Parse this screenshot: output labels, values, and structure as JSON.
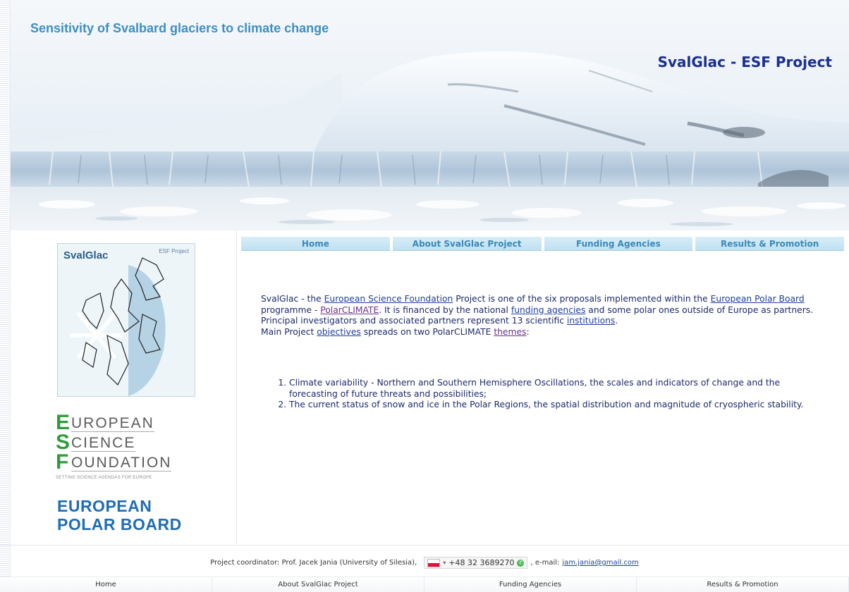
{
  "header": {
    "site_title": "Sensitivity of Svalbard glaciers to climate change",
    "project_title": "SvalGlac - ESF Project"
  },
  "logos": {
    "svalglac": {
      "brand": "SvalGlac",
      "sub": "ESF Project"
    },
    "esf": {
      "lines": [
        {
          "letter": "E",
          "word": "UROPEAN"
        },
        {
          "letter": "S",
          "word": "CIENCE"
        },
        {
          "letter": "F",
          "word": "OUNDATION"
        }
      ],
      "tagline": "SETTING SCIENCE AGENDAS FOR EUROPE"
    },
    "epb": {
      "line1": "EUROPEAN",
      "line2": "POLAR BOARD"
    }
  },
  "nav": {
    "items": [
      "Home",
      "About SvalGlac Project",
      "Funding Agencies",
      "Results & Promotion"
    ]
  },
  "content": {
    "p1": "SvalGlac - the ",
    "link_esf": "European Science Foundation",
    "p2": " Project is one of the six proposals implemented within the ",
    "link_epb": "European Polar Board",
    "p3": " programme - ",
    "link_polarclimate": "PolarCLIMATE",
    "p4": ". It is financed by the national ",
    "link_funding": "funding agencies",
    "p5": " and some polar ones outside of Europe as partners. Principal investigators and associated partners represent 13 scientific ",
    "link_institutions": "institutions",
    "p6": ".",
    "p7": "Main Project ",
    "link_objectives": "objectives",
    "p8": " spreads on two PolarCLIMATE ",
    "link_themes": "themes",
    "p9": ":",
    "list": [
      "Climate variability - Northern and Southern Hemisphere Oscillations, the scales and indicators of change and the forecasting of future threats and possibilities;",
      "The current status of snow and ice in the Polar Regions, the spatial distribution and magnitude of cryospheric stability."
    ]
  },
  "footer": {
    "coordinator": "Project coordinator: Prof. Jacek Jania (University of Silesia),",
    "phone": "+48 32 3689270",
    "email_label": ", e-mail:",
    "email": "jam.jania@gmail.com",
    "nav": [
      "Home",
      "About SvalGlac Project",
      "Funding Agencies",
      "Results & Promotion"
    ]
  },
  "colors": {
    "site_title": "#3d8fc1",
    "project_title": "#1b2f8f",
    "nav_text": "#3a89b8",
    "body_text": "#1d2a6b",
    "esf_green": "#2f9c3c",
    "epb_blue": "#1f6db2"
  }
}
